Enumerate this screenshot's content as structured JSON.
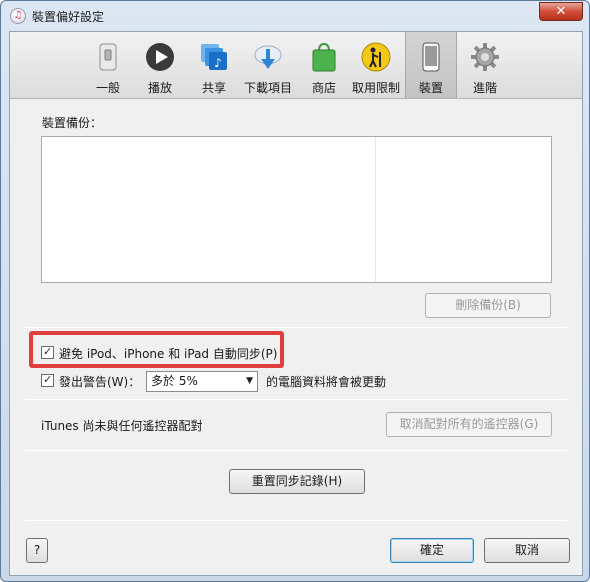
{
  "window": {
    "title": "裝置偏好設定",
    "close_glyph": "✕"
  },
  "toolbar": {
    "items": [
      {
        "label": "一般",
        "icon": "general-switch-icon"
      },
      {
        "label": "播放",
        "icon": "play-icon"
      },
      {
        "label": "共享",
        "icon": "sharing-icon"
      },
      {
        "label": "下載項目",
        "icon": "download-icon"
      },
      {
        "label": "商店",
        "icon": "store-bag-icon"
      },
      {
        "label": "取用限制",
        "icon": "parental-restrictions-icon"
      },
      {
        "label": "裝置",
        "icon": "device-phone-icon",
        "selected": true
      },
      {
        "label": "進階",
        "icon": "gear-icon"
      }
    ]
  },
  "backups": {
    "label": "裝置備份：",
    "delete_button": "刪除備份(B)"
  },
  "sync": {
    "prevent_auto_sync_label": "避免 iPod、iPhone 和 iPad 自動同步(P)",
    "prevent_auto_sync_checked": true,
    "warn_label": "發出警告(W)：",
    "warn_checked": true,
    "warn_threshold": "多於 5%",
    "warn_suffix": "的電腦資料將會被更動"
  },
  "remotes": {
    "status_text": "iTunes 尚未與任何遙控器配對",
    "forget_button": "取消配對所有的遙控器(G)"
  },
  "reset_sync_button": "重置同步記錄(H)",
  "footer": {
    "help_button": "?",
    "ok_button": "確定",
    "cancel_button": "取消"
  },
  "colors": {
    "highlight": "#e0403b",
    "titlebar": "#dce7f3",
    "close_button": "#cf4f3a"
  }
}
